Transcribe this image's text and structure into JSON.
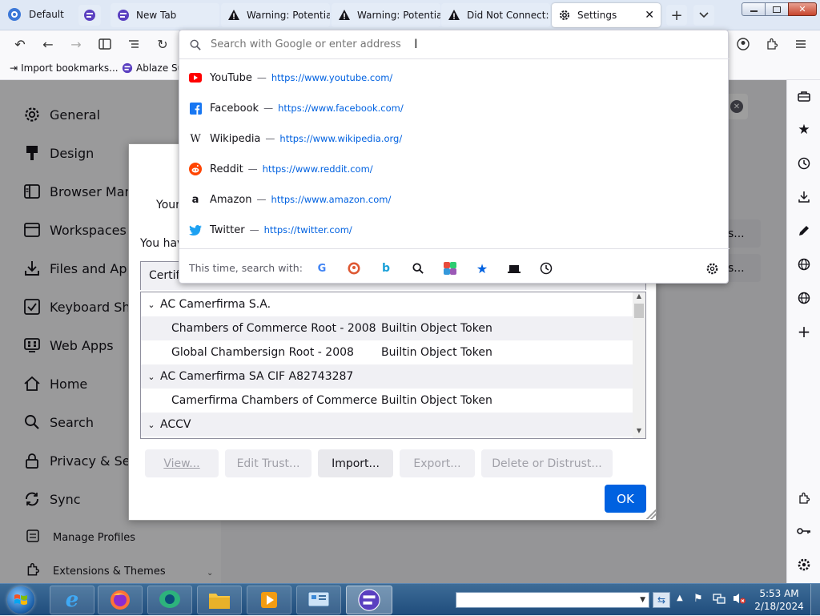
{
  "tabs": {
    "profile_label": "Default",
    "items": [
      {
        "label": "New Tab"
      },
      {
        "label": "Warning: Potential"
      },
      {
        "label": "Warning: Potential"
      },
      {
        "label": "Did Not Connect: I"
      },
      {
        "label": "Settings"
      }
    ]
  },
  "urlbar": {
    "placeholder": "Search with Google or enter address"
  },
  "bookmarks": [
    {
      "label": "Import bookmarks..."
    },
    {
      "label": "Ablaze Su"
    }
  ],
  "suggestions": [
    {
      "name": "YouTube",
      "sep": "—",
      "url": "https://www.youtube.com/",
      "color": "#ff0000"
    },
    {
      "name": "Facebook",
      "sep": "—",
      "url": "https://www.facebook.com/",
      "color": "#1877f2"
    },
    {
      "name": "Wikipedia",
      "sep": "—",
      "url": "https://www.wikipedia.org/",
      "color": "#000000"
    },
    {
      "name": "Reddit",
      "sep": "—",
      "url": "https://www.reddit.com/",
      "color": "#ff4500"
    },
    {
      "name": "Amazon",
      "sep": "—",
      "url": "https://www.amazon.com/",
      "color": "#000000"
    },
    {
      "name": "Twitter",
      "sep": "—",
      "url": "https://twitter.com/",
      "color": "#1da1f2"
    }
  ],
  "search_with_label": "This time, search with:",
  "settings_nav": [
    {
      "label": "General"
    },
    {
      "label": "Design"
    },
    {
      "label": "Browser Mana"
    },
    {
      "label": "Workspaces"
    },
    {
      "label": "Files and Appl"
    },
    {
      "label": "Keyboard Sho"
    },
    {
      "label": "Web Apps"
    },
    {
      "label": "Home"
    },
    {
      "label": "Search"
    },
    {
      "label": "Privacy & Secu"
    },
    {
      "label": "Sync"
    }
  ],
  "settings_bottom": [
    {
      "label": "Manage Profiles"
    },
    {
      "label": "Extensions & Themes"
    }
  ],
  "dialog": {
    "tab_label": "Your",
    "intro": "You hav",
    "column_header": "Certif",
    "rows": [
      {
        "type": "group",
        "label": "AC Camerfirma S.A."
      },
      {
        "type": "item",
        "name": "Chambers of Commerce Root - 2008",
        "token": "Builtin Object Token"
      },
      {
        "type": "item",
        "name": "Global Chambersign Root - 2008",
        "token": "Builtin Object Token"
      },
      {
        "type": "group",
        "label": "AC Camerfirma SA CIF A82743287"
      },
      {
        "type": "item",
        "name": "Camerfirma Chambers of Commerce ...",
        "token": "Builtin Object Token"
      },
      {
        "type": "group",
        "label": "ACCV"
      }
    ],
    "buttons": {
      "view": "View...",
      "edit_trust": "Edit Trust...",
      "import": "Import...",
      "export": "Export...",
      "delete": "Delete or Distrust..."
    },
    "ok": "OK"
  },
  "behind_buttons": [
    "es...",
    "es..."
  ],
  "taskbar": {
    "time": "5:53 AM",
    "date": "2/18/2024"
  },
  "colors": {
    "accent": "#0061e0",
    "ok_button": "#0061e0"
  }
}
